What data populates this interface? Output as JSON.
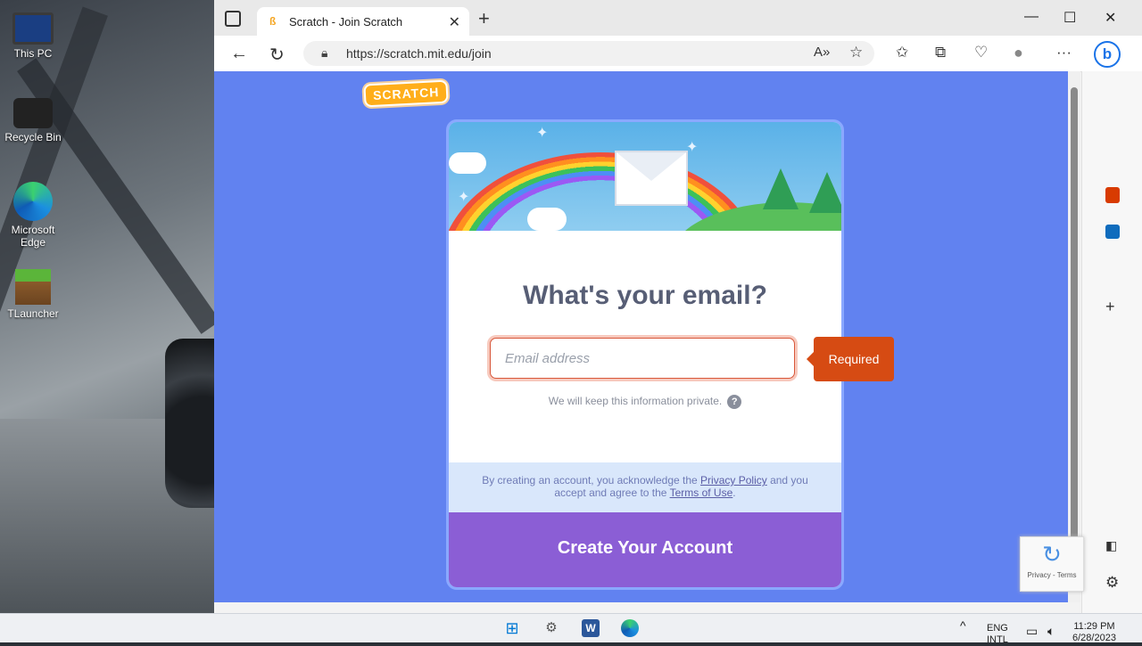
{
  "desktop": {
    "icons": [
      {
        "label": "This PC"
      },
      {
        "label": "Recycle Bin"
      },
      {
        "label": "Microsoft Edge"
      },
      {
        "label": "TLauncher"
      }
    ]
  },
  "browser": {
    "tab": {
      "title": "Scratch - Join Scratch"
    },
    "url": "https://scratch.mit.edu/join",
    "window_controls": {
      "minimize": "—",
      "maximize": "☐",
      "close": "✕"
    }
  },
  "page": {
    "logo_text": "SCRATCH",
    "heading": "What's your email?",
    "email": {
      "value": "",
      "placeholder": "Email address"
    },
    "validation": "Required",
    "privacy_note": "We will keep this information private.",
    "terms": {
      "prefix": "By creating an account, you acknowledge the",
      "privacy_link": "Privacy Policy",
      "middle": "and you accept and agree to the",
      "terms_link": "Terms of Use",
      "suffix": "."
    },
    "create_button": "Create Your Account",
    "recaptcha": {
      "links": "Privacy - Terms"
    }
  },
  "taskbar": {
    "language": "ENG",
    "language_sub": "INTL",
    "time": "11:29 PM",
    "date": "6/28/2023"
  },
  "colors": {
    "page_bg": "#6182f0",
    "create_button": "#8b5ed5",
    "required_badge": "#d64b13"
  }
}
